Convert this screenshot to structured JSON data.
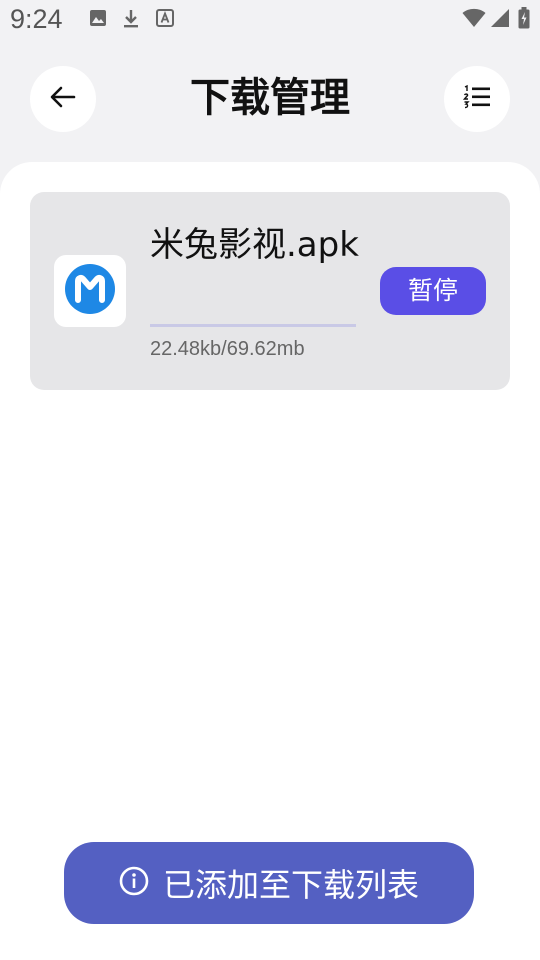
{
  "status_bar": {
    "time": "9:24",
    "icons": [
      "image-icon",
      "download-icon",
      "font-icon",
      "wifi-icon",
      "signal-icon",
      "battery-icon"
    ]
  },
  "header": {
    "title": "下载管理",
    "back_icon": "arrow-left-icon",
    "menu_icon": "numbered-list-icon"
  },
  "downloads": [
    {
      "file_name": "米兔影视.apk",
      "size_text": "22.48kb/69.62mb",
      "progress": 0.0003,
      "action_label": "暂停",
      "icon": "app-m-logo-icon"
    }
  ],
  "toast": {
    "icon": "info-icon",
    "message": "已添加至下载列表"
  },
  "colors": {
    "accent": "#5a4ee6",
    "toast_bg": "#5460c2",
    "app_logo": "#1e88e5",
    "card_bg": "#e6e6e8"
  }
}
